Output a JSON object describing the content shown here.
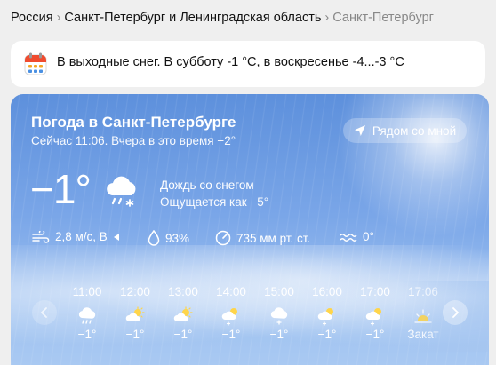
{
  "breadcrumb": {
    "items": [
      "Россия",
      "Санкт-Петербург и Ленинградская область",
      "Санкт-Петербург"
    ],
    "separator": "›"
  },
  "notice": {
    "text": "В выходные снег. В субботу -1 °C, в воскресенье -4...-3 °C",
    "icon": "calendar-icon"
  },
  "weather": {
    "title": "Погода в Санкт-Петербурге",
    "subtitle": "Сейчас 11:06. Вчера в это время −2°",
    "nearby_label": "Рядом со мной",
    "temperature": "−1°",
    "condition": "Дождь со снегом",
    "feels_like": "Ощущается как −5°",
    "wind": "2,8 м/с, В",
    "humidity": "93%",
    "pressure": "735 мм рт. ст.",
    "water": "0°"
  },
  "hourly": [
    {
      "time": "11:00",
      "icon": "rain-snow-cloud-icon",
      "temp": "−1°"
    },
    {
      "time": "12:00",
      "icon": "partly-cloudy-icon",
      "temp": "−1°"
    },
    {
      "time": "13:00",
      "icon": "partly-cloudy-icon",
      "temp": "−1°"
    },
    {
      "time": "14:00",
      "icon": "partly-cloudy-snow-icon",
      "temp": "−1°"
    },
    {
      "time": "15:00",
      "icon": "snow-cloud-icon",
      "temp": "−1°"
    },
    {
      "time": "16:00",
      "icon": "partly-cloudy-snow-icon",
      "temp": "−1°"
    },
    {
      "time": "17:00",
      "icon": "partly-cloudy-snow-icon",
      "temp": "−1°"
    },
    {
      "time": "17:06",
      "icon": "sunset-icon",
      "temp": "Закат"
    }
  ],
  "colors": {
    "card_top": "#5d90dc",
    "card_bottom": "#a9c9f2",
    "text": "#ffffff"
  }
}
